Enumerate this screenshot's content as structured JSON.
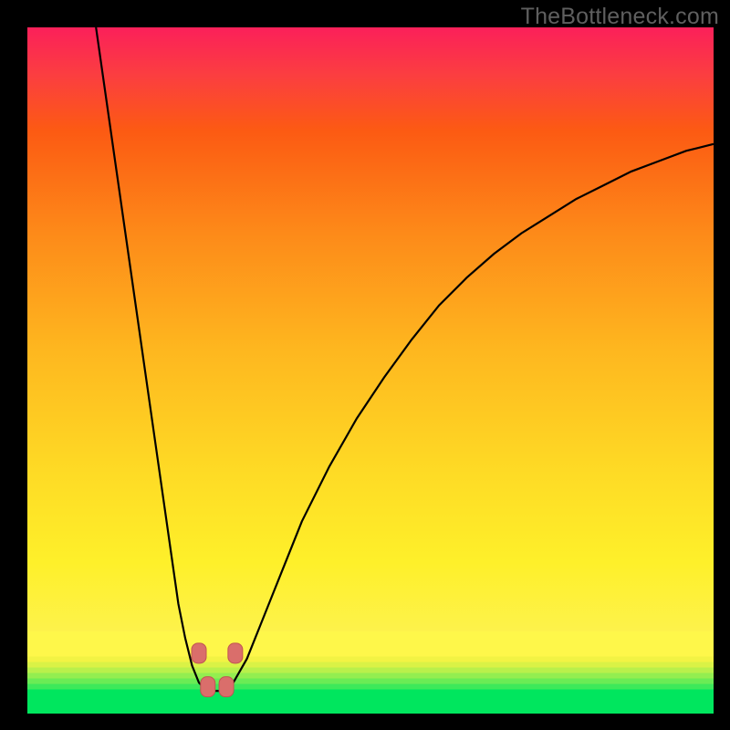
{
  "watermark": "TheBottleneck.com",
  "colors": {
    "frame": "#000000",
    "watermark": "#5f5f5f",
    "curve_stroke": "#000000",
    "marker_fill": "#da6e6b",
    "marker_stroke": "#c15552"
  },
  "chart_data": {
    "type": "line",
    "title": "",
    "xlabel": "",
    "ylabel": "",
    "xlim": [
      0,
      100
    ],
    "ylim": [
      0,
      100
    ],
    "grid": false,
    "legend": false,
    "series": [
      {
        "name": "bottleneck-curve",
        "x": [
          10,
          11,
          12,
          13,
          14,
          15,
          16,
          17,
          18,
          19,
          20,
          21,
          22,
          23,
          24,
          25,
          26,
          27,
          28,
          29,
          30,
          32,
          34,
          36,
          38,
          40,
          44,
          48,
          52,
          56,
          60,
          64,
          68,
          72,
          76,
          80,
          84,
          88,
          92,
          96,
          100
        ],
        "y": [
          100,
          93,
          86,
          79,
          72,
          65,
          58,
          51,
          44,
          37,
          30,
          23,
          16,
          11,
          7,
          4.5,
          3.5,
          3.3,
          3.3,
          3.5,
          4.5,
          8,
          13,
          18,
          23,
          28,
          36,
          43,
          49,
          54.5,
          59.5,
          63.5,
          67,
          70,
          72.5,
          75,
          77,
          79,
          80.5,
          82,
          83
        ]
      }
    ],
    "markers": [
      {
        "x": 25.0,
        "y": 8.8
      },
      {
        "x": 30.3,
        "y": 8.8
      },
      {
        "x": 26.3,
        "y": 3.9
      },
      {
        "x": 29.0,
        "y": 3.9
      }
    ],
    "marker_shape": "rounded-rect",
    "gradient_stops_top_to_bottom": [
      {
        "pos": 0.0,
        "color": "#fb205a"
      },
      {
        "pos": 0.07,
        "color": "#fb3e40"
      },
      {
        "pos": 0.15,
        "color": "#fc5a13"
      },
      {
        "pos": 0.3,
        "color": "#fd8a19"
      },
      {
        "pos": 0.47,
        "color": "#feb71f"
      },
      {
        "pos": 0.65,
        "color": "#fedb25"
      },
      {
        "pos": 0.78,
        "color": "#fef02a"
      },
      {
        "pos": 0.88,
        "color": "#fef74a"
      },
      {
        "pos": 0.97,
        "color": "#3de95a"
      },
      {
        "pos": 1.0,
        "color": "#00e65e"
      }
    ]
  }
}
